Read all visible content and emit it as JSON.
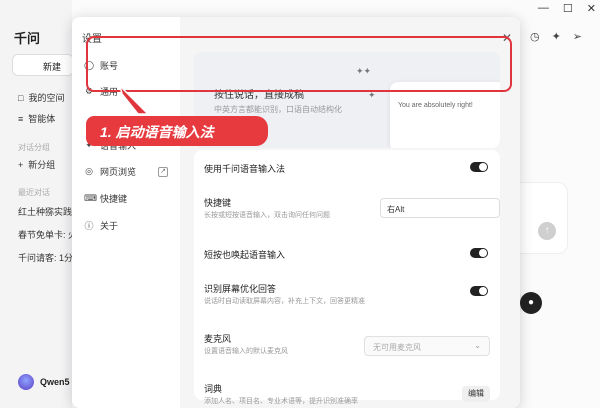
{
  "app": {
    "title": "千问",
    "new_chat_label": "新建",
    "sidebar": [
      {
        "label": "我的空间",
        "icon": "folder-icon"
      },
      {
        "label": "智能体",
        "icon": "list-icon"
      }
    ],
    "group_section_label": "对话分组",
    "new_group_label": "新分组",
    "recent_section_label": "最近对话",
    "history": [
      "红土种猕实践说",
      "春节免单卡: 火",
      "千问请客: 1分"
    ],
    "user_name": "Qwen5"
  },
  "settings_modal": {
    "title": "设置",
    "nav": [
      {
        "label": "账号",
        "icon": "user-icon"
      },
      {
        "label": "通用",
        "icon": "settings-icon"
      },
      {
        "label": "语音输入",
        "icon": "mic-icon"
      },
      {
        "label": "网页浏览",
        "icon": "compass-icon"
      },
      {
        "label": "快捷键",
        "icon": "keyboard-icon"
      },
      {
        "label": "关于",
        "icon": "info-icon"
      }
    ],
    "banner": {
      "title": "按住说话，直接成稿",
      "subtitle": "中英方言都能识别，口语自动结构化",
      "card_text": "You are absolutely right!"
    },
    "rows": {
      "enable_voice": {
        "title": "使用千问语音输入法",
        "enabled": true
      },
      "hotkey": {
        "title": "快捷键",
        "desc": "长按或短按语音输入，双击询问任何问题",
        "value": "右Alt"
      },
      "short_press": {
        "title": "短按也唤起语音输入",
        "enabled": true
      },
      "screen_optimize": {
        "title": "识别屏幕优化回答",
        "desc": "说话时自动读取屏幕内容，补充上下文，回答更精准",
        "enabled": true
      },
      "microphone": {
        "title": "麦克风",
        "desc": "设置语音输入的默认麦克风",
        "placeholder": "无可用麦克风"
      },
      "dictionary": {
        "title": "词典",
        "desc": "添加人名、项目名、专业术语等，提升识别准确率",
        "button": "编辑"
      }
    }
  },
  "annotation": {
    "step_label": "1. 启动语音输入法",
    "color": "#e0353c"
  }
}
